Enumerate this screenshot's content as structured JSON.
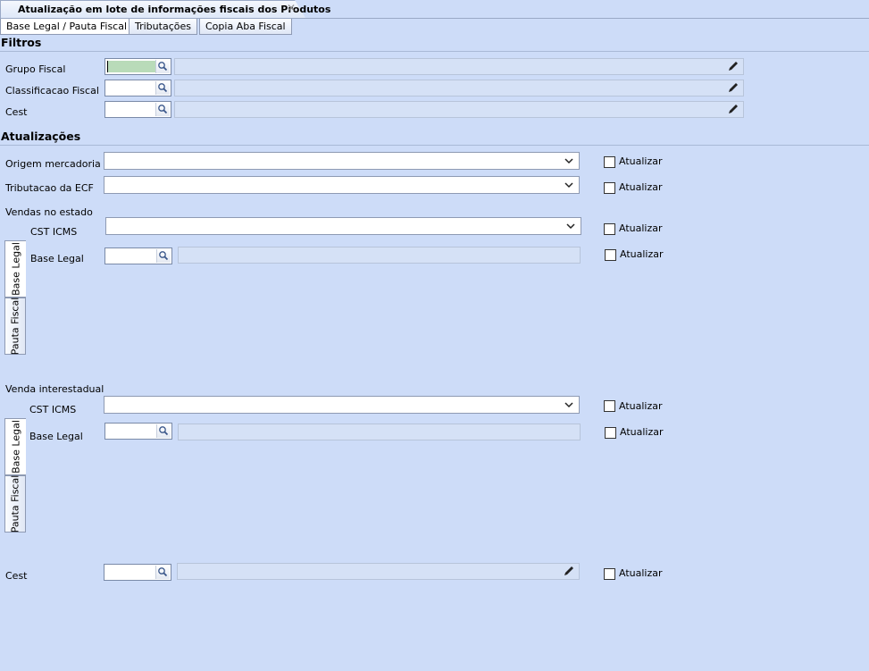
{
  "window_tab": {
    "title": "Atualização em lote de informações fiscais dos Produtos",
    "close": "✕"
  },
  "tabs": [
    "Base Legal / Pauta Fiscal",
    "Tributações",
    "Copia Aba Fiscal"
  ],
  "filtros": {
    "title": "Filtros",
    "grupo_fiscal": "Grupo Fiscal",
    "classificacao_fiscal": "Classificacao Fiscal",
    "cest": "Cest"
  },
  "atualizacoes": {
    "title": "Atualizações",
    "origem_mercadoria": "Origem mercadoria",
    "tributacao_ecf": "Tributacao da ECF",
    "vendas_estado": "Vendas no estado",
    "venda_interestadual": "Venda interestadual",
    "cst_icms": "CST ICMS",
    "base_legal": "Base Legal",
    "cest": "Cest",
    "atualizar": "Atualizar"
  },
  "side_tabs": [
    "Base Legal",
    "Pauta Fiscal"
  ]
}
